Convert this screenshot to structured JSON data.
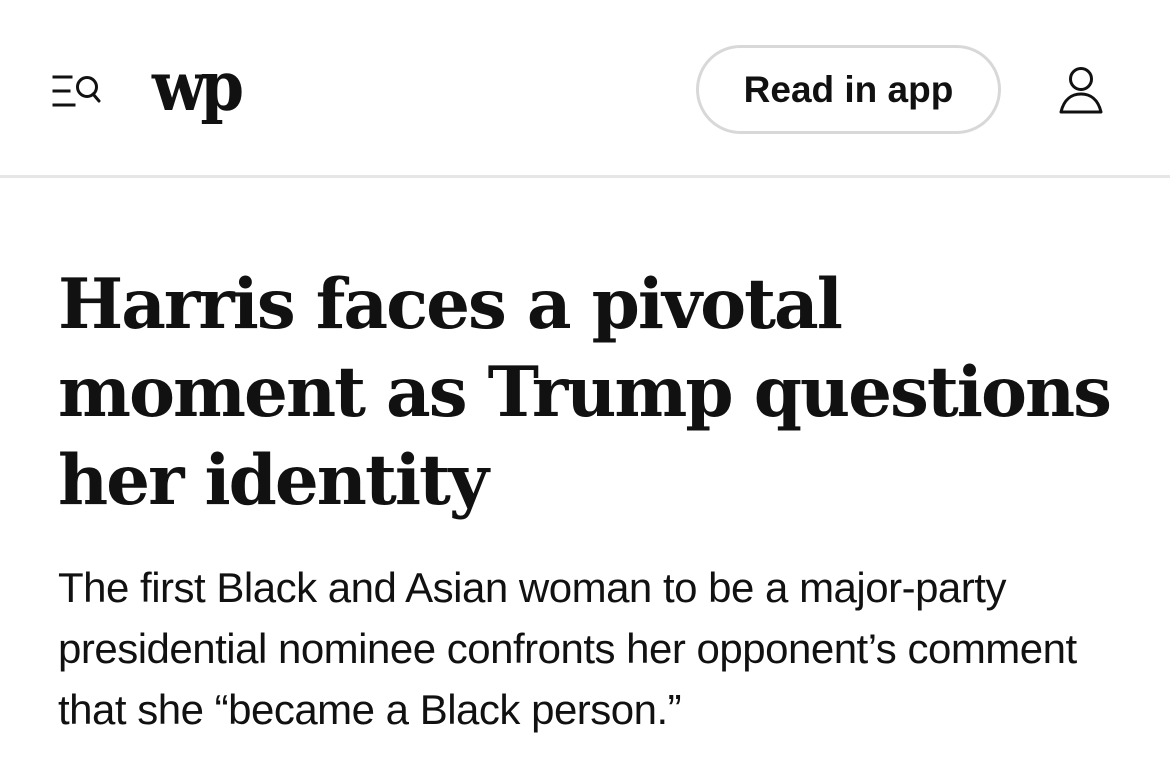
{
  "header": {
    "logo_text": "wp",
    "read_in_app_label": "Read in app",
    "icons": {
      "menu_search": "menu-search-icon",
      "account": "account-icon"
    }
  },
  "article": {
    "headline": "Harris faces a pivotal moment as Trump questions her identity",
    "dek": "The first Black and Asian woman to be a major-party presidential nominee confronts her opponent’s comment that she “became a Black person.”"
  }
}
